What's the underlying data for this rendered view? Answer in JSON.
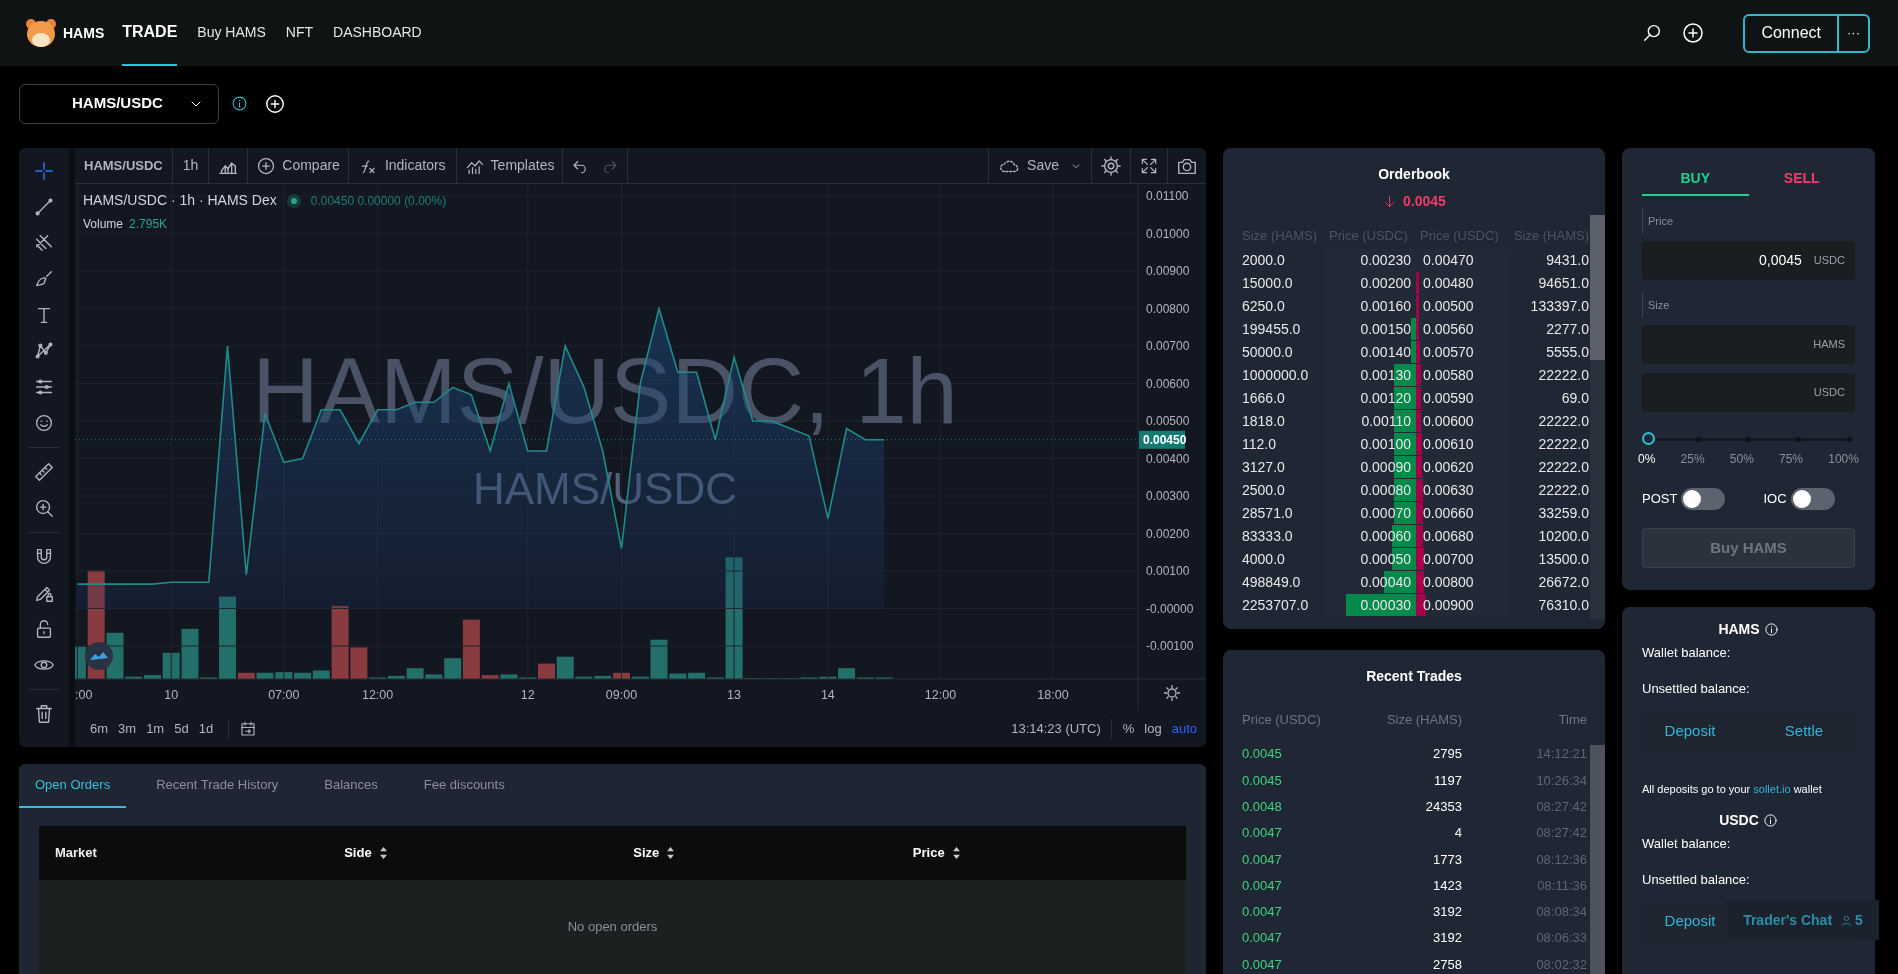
{
  "nav": {
    "brand": "HAMS",
    "links": [
      {
        "label": "TRADE",
        "selected": true
      },
      {
        "label": "Buy HAMS",
        "selected": false
      },
      {
        "label": "NFT",
        "selected": false
      },
      {
        "label": "DASHBOARD",
        "selected": false
      }
    ],
    "connect": "Connect",
    "more": "···"
  },
  "market": {
    "symbol": "HAMS/USDC"
  },
  "chart": {
    "tools": [
      {
        "kind": "crosshair",
        "selected": true
      },
      {
        "kind": "trend-line",
        "selected": false
      },
      {
        "kind": "pitchfork",
        "selected": false
      },
      {
        "kind": "brush",
        "selected": false
      },
      {
        "kind": "text",
        "selected": false
      },
      {
        "kind": "pattern",
        "selected": false
      },
      {
        "kind": "forecast",
        "selected": false
      },
      {
        "kind": "emoji",
        "selected": false
      },
      {
        "kind": "ruler",
        "selected": false
      },
      {
        "kind": "zoom",
        "selected": false
      },
      {
        "kind": "magnet",
        "selected": false
      },
      {
        "kind": "lock-drawing",
        "selected": false
      },
      {
        "kind": "lock",
        "selected": false
      },
      {
        "kind": "eye",
        "selected": false
      },
      {
        "kind": "trash",
        "selected": false
      }
    ],
    "toolbar": {
      "symbol": "HAMS/USDC",
      "interval": "1h",
      "compare": "Compare",
      "indicators": "Indicators",
      "templates": "Templates",
      "save": "Save"
    },
    "legend": {
      "title": "HAMS/USDC · 1h · HAMS Dex",
      "values": "0.00450 0.00000 (0.00%)",
      "volume_label": "Volume",
      "volume_value": "2.795K"
    },
    "watermark": "HAMS/USDC, 1h",
    "watermark_sub": "HAMS/USDC",
    "last_price": "0.00450",
    "chart_data": {
      "type": "area",
      "categories": [
        ":00",
        null,
        null,
        null,
        null,
        "10",
        null,
        null,
        null,
        null,
        null,
        "07:00",
        null,
        null,
        null,
        null,
        "12:00",
        null,
        null,
        null,
        null,
        null,
        null,
        null,
        "12",
        null,
        null,
        null,
        null,
        "09:00",
        null,
        null,
        null,
        null,
        null,
        "13",
        null,
        null,
        null,
        null,
        "14",
        null,
        null,
        null,
        null,
        null,
        "12:00",
        null,
        null,
        null,
        null,
        null,
        "18:00",
        null,
        null,
        null,
        null
      ],
      "series": [
        {
          "color": "#1f8c86",
          "values": [
            0.00065,
            0.00065,
            0.00065,
            0.00065,
            0.00065,
            0.0007,
            0.0007,
            0.0007,
            0.007,
            0.0009,
            0.0052,
            0.0039,
            0.004,
            0.0053,
            0.0053,
            0.0044,
            0.0053,
            0.0053,
            0.0055,
            0.0055,
            0.0059,
            0.0057,
            0.0042,
            0.006,
            0.0042,
            0.0042,
            0.007,
            0.0059,
            0.0042,
            0.0016,
            0.006,
            0.008,
            0.0063,
            0.0063,
            0.0045,
            0.0067,
            0.005,
            0.005,
            0.0048,
            0.0046,
            0.0024,
            0.0048,
            0.0045,
            0.0045,
            null,
            null,
            null,
            null,
            null,
            null,
            null,
            null,
            null,
            null,
            null,
            null,
            null
          ]
        }
      ],
      "ylim": [
        -0.00188,
        0.01132
      ],
      "grid": true,
      "ref_lines": [
        {
          "axis": "y",
          "value": 0.0045
        }
      ],
      "yticks": [
        {
          "value": 0.011,
          "label": "0.01100"
        },
        {
          "value": 0.01,
          "label": "0.01000"
        },
        {
          "value": 0.009,
          "label": "0.00900"
        },
        {
          "value": 0.008,
          "label": "0.00800"
        },
        {
          "value": 0.007,
          "label": "0.00700"
        },
        {
          "value": 0.006,
          "label": "0.00600"
        },
        {
          "value": 0.005,
          "label": "0.00500"
        },
        {
          "value": 0.004,
          "label": "0.00400"
        },
        {
          "value": 0.003,
          "label": "0.00300"
        },
        {
          "value": 0.002,
          "label": "0.00200"
        },
        {
          "value": 0.001,
          "label": "0.00100"
        },
        {
          "value": 0,
          "label": "-0.00000"
        },
        {
          "value": -0.001,
          "label": "-0.00100"
        }
      ]
    },
    "ranges": [
      "6m",
      "3m",
      "1m",
      "5d",
      "1d"
    ],
    "time": "13:14:23 (UTC)",
    "scales": [
      {
        "label": "%",
        "selected": false
      },
      {
        "label": "log",
        "selected": false
      },
      {
        "label": "auto",
        "selected": true
      }
    ]
  },
  "orderbook": {
    "title": "Orderbook",
    "last_price": "0.0045",
    "columns": [
      "Size (HAMS)",
      "Price (USDC)",
      "Price (USDC)",
      "Size (HAMS)"
    ],
    "rows": [
      {
        "bid": {
          "size": "2000.0",
          "price": "0.00230"
        },
        "ask": {
          "price": "0.00470",
          "size": "9431.0"
        }
      },
      {
        "bid": {
          "size": "15000.0",
          "price": "0.00200"
        },
        "ask": {
          "price": "0.00480",
          "size": "94651.0",
          "level": 0.03
        }
      },
      {
        "bid": {
          "size": "6250.0",
          "price": "0.00160"
        },
        "ask": {
          "price": "0.00500",
          "size": "133397.0",
          "level": 0.03
        }
      },
      {
        "bid": {
          "size": "199455.0",
          "price": "0.00150",
          "level": 0.05
        },
        "ask": {
          "price": "0.00560",
          "size": "2277.0",
          "level": 0.03
        }
      },
      {
        "bid": {
          "size": "50000.0",
          "price": "0.00140",
          "level": 0.05
        },
        "ask": {
          "price": "0.00570",
          "size": "5555.0",
          "level": 0.04
        }
      },
      {
        "bid": {
          "size": "1000000.0",
          "price": "0.00130",
          "level": 0.24
        },
        "ask": {
          "price": "0.00580",
          "size": "22222.0",
          "level": 0.05
        }
      },
      {
        "bid": {
          "size": "1666.0",
          "price": "0.00120",
          "level": 0.24
        },
        "ask": {
          "price": "0.00590",
          "size": "69.0",
          "level": 0.05
        }
      },
      {
        "bid": {
          "size": "1818.0",
          "price": "0.00110",
          "level": 0.24
        },
        "ask": {
          "price": "0.00600",
          "size": "22222.0",
          "level": 0.05
        }
      },
      {
        "bid": {
          "size": "112.0",
          "price": "0.00100",
          "level": 0.24
        },
        "ask": {
          "price": "0.00610",
          "size": "22222.0",
          "level": 0.06
        }
      },
      {
        "bid": {
          "size": "3127.0",
          "price": "0.00090",
          "level": 0.24
        },
        "ask": {
          "price": "0.00620",
          "size": "22222.0",
          "level": 0.06
        }
      },
      {
        "bid": {
          "size": "2500.0",
          "price": "0.00080",
          "level": 0.24
        },
        "ask": {
          "price": "0.00630",
          "size": "22222.0",
          "level": 0.07
        }
      },
      {
        "bid": {
          "size": "28571.0",
          "price": "0.00070",
          "level": 0.24
        },
        "ask": {
          "price": "0.00660",
          "size": "33259.0",
          "level": 0.07
        }
      },
      {
        "bid": {
          "size": "83333.0",
          "price": "0.00060",
          "level": 0.26
        },
        "ask": {
          "price": "0.00680",
          "size": "10200.0",
          "level": 0.07
        }
      },
      {
        "bid": {
          "size": "4000.0",
          "price": "0.00050",
          "level": 0.26
        },
        "ask": {
          "price": "0.00700",
          "size": "13500.0",
          "level": 0.08
        }
      },
      {
        "bid": {
          "size": "498849.0",
          "price": "0.00040",
          "level": 0.35
        },
        "ask": {
          "price": "0.00800",
          "size": "26672.0",
          "level": 0.08
        }
      },
      {
        "bid": {
          "size": "2253707.0",
          "price": "0.00030",
          "level": 0.77
        },
        "ask": {
          "price": "0.00900",
          "size": "76310.0",
          "level": 0.1
        }
      }
    ]
  },
  "recent_trades": {
    "title": "Recent Trades",
    "columns": [
      "Price (USDC)",
      "Size (HAMS)",
      "Time"
    ],
    "rows": [
      {
        "price": "0.0045",
        "size": "2795",
        "time": "14:12:21"
      },
      {
        "price": "0.0045",
        "size": "1197",
        "time": "10:26:34"
      },
      {
        "price": "0.0048",
        "size": "24353",
        "time": "08:27:42"
      },
      {
        "price": "0.0047",
        "size": "4",
        "time": "08:27:42"
      },
      {
        "price": "0.0047",
        "size": "1773",
        "time": "08:12:36"
      },
      {
        "price": "0.0047",
        "size": "1423",
        "time": "08:11:36"
      },
      {
        "price": "0.0047",
        "size": "3192",
        "time": "08:08:34"
      },
      {
        "price": "0.0047",
        "size": "3192",
        "time": "08:06:33"
      },
      {
        "price": "0.0047",
        "size": "2758",
        "time": "08:02:32"
      }
    ]
  },
  "order_form": {
    "tabs": [
      {
        "label": "BUY",
        "selected": true
      },
      {
        "label": "SELL",
        "selected": false
      }
    ],
    "price": {
      "label": "Price",
      "value": "0,0045",
      "unit": "USDC"
    },
    "size": {
      "label": "Size",
      "unit": "HAMS"
    },
    "total": {
      "unit": "USDC"
    },
    "slider": {
      "level": 0,
      "marks": [
        {
          "label": "0%",
          "selected": true
        },
        {
          "label": "25%",
          "selected": false
        },
        {
          "label": "50%",
          "selected": false
        },
        {
          "label": "75%",
          "selected": false
        },
        {
          "label": "100%",
          "selected": false
        }
      ]
    },
    "toggles": [
      {
        "label": "POST",
        "on": false
      },
      {
        "label": "IOC",
        "on": false
      }
    ],
    "submit": {
      "label": "Buy HAMS",
      "disabled": true
    }
  },
  "balances": [
    {
      "currency": "HAMS",
      "wallet_label": "Wallet balance:",
      "unsettled_label": "Unsettled balance:",
      "buttons": [
        "Deposit",
        "Settle"
      ],
      "note": {
        "before": "All deposits go to your",
        "link": "sollet.io",
        "after": "wallet"
      }
    },
    {
      "currency": "USDC",
      "wallet_label": "Wallet balance:",
      "unsettled_label": "Unsettled balance:",
      "buttons": [
        "Deposit"
      ]
    }
  ],
  "chat": {
    "label": "Trader's Chat",
    "count": "5"
  },
  "orders": {
    "tabs": [
      {
        "label": "Open Orders",
        "selected": true
      },
      {
        "label": "Recent Trade History",
        "selected": false
      },
      {
        "label": "Balances",
        "selected": false
      },
      {
        "label": "Fee discounts",
        "selected": false
      }
    ],
    "columns": [
      {
        "label": "Market",
        "sortable": false
      },
      {
        "label": "Side",
        "sortable": true
      },
      {
        "label": "Size",
        "sortable": true
      },
      {
        "label": "Price",
        "sortable": true
      }
    ],
    "empty": "No open orders"
  }
}
